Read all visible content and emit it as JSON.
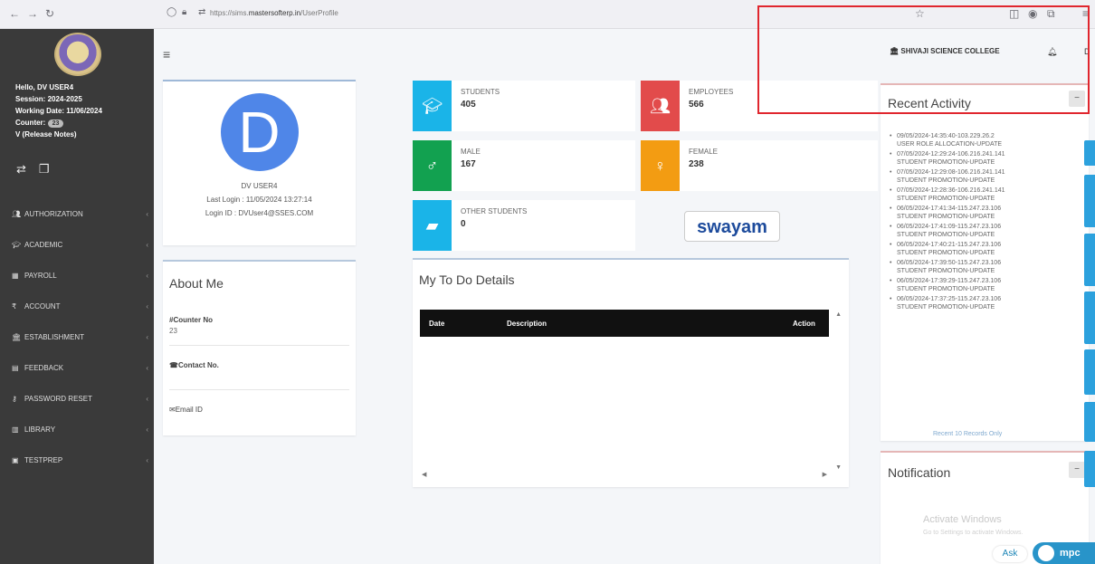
{
  "browser": {
    "url_prefix": "https://sims.",
    "url_domain": "mastersofterp.in",
    "url_path": "/UserProfile"
  },
  "sidebar": {
    "user_lines": [
      "Hello, DV USER4",
      "Session: 2024-2025",
      "Working Date: 11/06/2024"
    ],
    "counter_label": "Counter:",
    "counter_value": "23",
    "release_notes": "V (Release Notes)",
    "menu": [
      {
        "label": "AUTHORIZATION",
        "icon": "users-icon"
      },
      {
        "label": "ACADEMIC",
        "icon": "graduation-cap-icon"
      },
      {
        "label": "PAYROLL",
        "icon": "table-icon"
      },
      {
        "label": "ACCOUNT",
        "icon": "rupee-icon"
      },
      {
        "label": "ESTABLISHMENT",
        "icon": "bank-icon"
      },
      {
        "label": "FEEDBACK",
        "icon": "feedback-icon"
      },
      {
        "label": "PASSWORD RESET",
        "icon": "key-icon"
      },
      {
        "label": "LIBRARY",
        "icon": "library-icon"
      },
      {
        "label": "TESTPREP",
        "icon": "testprep-icon"
      }
    ]
  },
  "header": {
    "college": "SHIVAJI SCIENCE COLLEGE",
    "truncated_text": "D"
  },
  "profile": {
    "initial": "D",
    "name": "DV USER4",
    "last_login": "Last Login : 11/05/2024 13:27:14",
    "login_id": "Login ID : DVUser4@SSES.COM"
  },
  "about": {
    "title": "About Me",
    "fields": [
      {
        "label": "Counter No",
        "value": "23"
      },
      {
        "label": "Contact No.",
        "value": ""
      },
      {
        "label": "Email ID",
        "value": ""
      }
    ]
  },
  "stats": {
    "students": {
      "label": "STUDENTS",
      "value": "405",
      "color": "#1ab4e8"
    },
    "employees": {
      "label": "EMPLOYEES",
      "value": "566",
      "color": "#e24b4b"
    },
    "male": {
      "label": "MALE",
      "value": "167",
      "color": "#12a150"
    },
    "female": {
      "label": "FEMALE",
      "value": "238",
      "color": "#f39c12"
    },
    "other": {
      "label": "OTHER STUDENTS",
      "value": "0",
      "color": "#1ab4e8"
    }
  },
  "swayam": "swayam",
  "todo": {
    "title": "My To Do Details",
    "columns": [
      "Date",
      "Description",
      "Action"
    ]
  },
  "activity": {
    "title": "Recent Activity",
    "items": [
      {
        "time": "09/05/2024-14:35:40-103.229.26.2",
        "action": "USER ROLE ALLOCATION-UPDATE"
      },
      {
        "time": "07/05/2024-12:29:24-106.216.241.141",
        "action": "STUDENT PROMOTION-UPDATE"
      },
      {
        "time": "07/05/2024-12:29:08-106.216.241.141",
        "action": "STUDENT PROMOTION-UPDATE"
      },
      {
        "time": "07/05/2024-12:28:36-106.216.241.141",
        "action": "STUDENT PROMOTION-UPDATE"
      },
      {
        "time": "06/05/2024-17:41:34-115.247.23.106",
        "action": "STUDENT PROMOTION-UPDATE"
      },
      {
        "time": "06/05/2024-17:41:09-115.247.23.106",
        "action": "STUDENT PROMOTION-UPDATE"
      },
      {
        "time": "06/05/2024-17:40:21-115.247.23.106",
        "action": "STUDENT PROMOTION-UPDATE"
      },
      {
        "time": "06/05/2024-17:39:50-115.247.23.106",
        "action": "STUDENT PROMOTION-UPDATE"
      },
      {
        "time": "06/05/2024-17:39:29-115.247.23.106",
        "action": "STUDENT PROMOTION-UPDATE"
      },
      {
        "time": "06/05/2024-17:37:25-115.247.23.106",
        "action": "STUDENT PROMOTION-UPDATE"
      }
    ],
    "footer": "Recent 10 Records Only"
  },
  "notification": {
    "title": "Notification"
  },
  "watermark": {
    "title": "Activate Windows",
    "subtitle": "Go to Settings to activate Windows."
  },
  "chat": {
    "ask": "Ask",
    "brand": "mpc"
  },
  "collapse_symbol": "−"
}
